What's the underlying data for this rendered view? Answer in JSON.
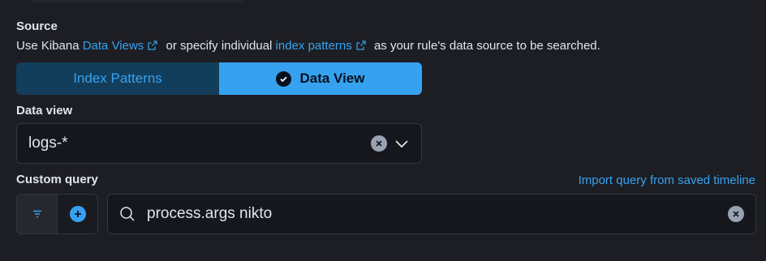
{
  "source": {
    "title": "Source",
    "help_prefix": "Use Kibana ",
    "link_data_views": "Data Views",
    "help_middle": " or specify individual ",
    "link_index_patterns": "index patterns",
    "help_suffix": " as your rule's data source to be searched."
  },
  "toggle": {
    "index_patterns": "Index Patterns",
    "data_view": "Data View",
    "selected": "Data View"
  },
  "data_view": {
    "label": "Data view",
    "value": "logs-*"
  },
  "custom_query": {
    "label": "Custom query",
    "import_link": "Import query from saved timeline",
    "value": "process.args nikto"
  },
  "icons": {
    "external": "external-link-icon",
    "check": "check-circle-icon",
    "clear": "clear-icon",
    "chevron": "chevron-down-icon",
    "filter": "filter-icon",
    "add": "plus-circle-icon",
    "search": "search-icon"
  },
  "colors": {
    "accent": "#36a2ef",
    "background": "#1d1e24",
    "selected_toggle_bg": "#36a2ef",
    "unselected_toggle_bg": "#123d5b"
  }
}
